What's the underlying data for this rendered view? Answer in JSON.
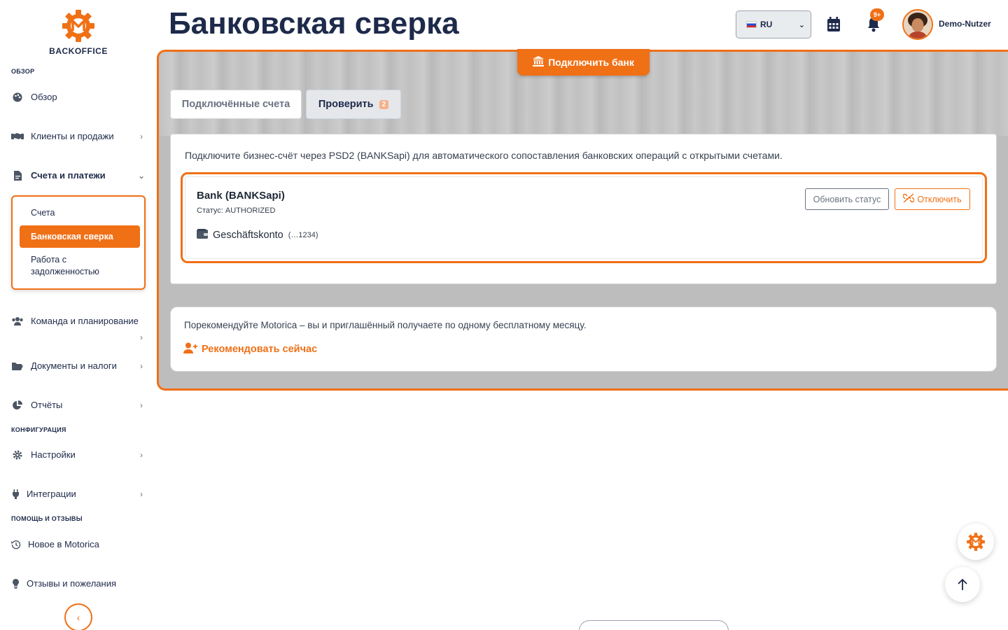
{
  "brand": {
    "logo_text": "BACKOFFICE",
    "accent": "#f07016",
    "navy": "#1e2a4a"
  },
  "sidebar": {
    "sections": {
      "overview": "ОБЗОР",
      "config": "КОНФИГУРАЦИЯ",
      "help": "ПОМОЩЬ И ОТЗЫВЫ"
    },
    "items": {
      "overview": "Обзор",
      "clients": "Клиенты и продажи",
      "invoices": "Счета и платежи",
      "team": "Команда и планирование",
      "documents": "Документы и налоги",
      "reports": "Отчёты",
      "settings": "Настройки",
      "integrations": "Интеграции",
      "news": "Новое в Motorica",
      "feedback": "Отзывы и пожелания"
    },
    "sub_items": {
      "bills": "Счета",
      "bank": "Банковская сверка",
      "debts": "Работа с задолженностью"
    }
  },
  "header": {
    "title": "Банковская сверка",
    "language": "RU",
    "notifications_badge": "9+",
    "user_name": "Demo-Nutzer"
  },
  "main": {
    "connect_bank_label": "Подключить банк",
    "tabs": {
      "connected": "Подключённые счета",
      "check": "Проверить",
      "check_count": "2"
    },
    "intro": "Подключите бизнес-счёт через PSD2 (BANKSapi) для автоматического сопоставления банковских операций с открытыми счетами.",
    "bank": {
      "name": "Bank (BANKSapi)",
      "status": "Статус: AUTHORIZED",
      "account_name": "Geschäftskonto",
      "account_number": "(…1234)",
      "refresh_label": "Обновить статус",
      "disconnect_label": "Отключить"
    },
    "referral": {
      "text": "Порекомендуйте Motorica – вы и приглашённый получаете по одному бесплатному месяцу.",
      "link": "Рекомендовать сейчас"
    }
  }
}
